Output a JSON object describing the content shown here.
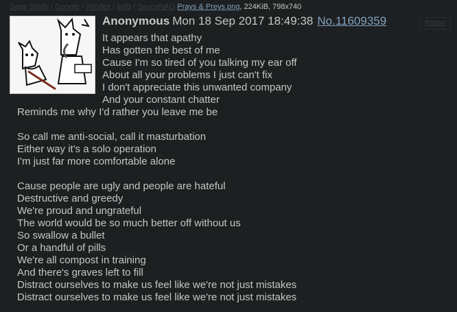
{
  "file": {
    "search_links": [
      "Sage Study",
      "Google",
      "Yandex",
      "iqdb",
      "SauceNAO"
    ],
    "filename": "Prays & Preys.png",
    "meta": ", 224KiB, 798x740"
  },
  "post": {
    "name": "Anonymous",
    "date": "Mon 18 Sep 2017 18:49:38",
    "number": "No.11609359",
    "report_label": "Report"
  },
  "body_lines": [
    "It appears that apathy",
    "Has gotten the best of me",
    "Cause I'm so tired of you talking my ear off",
    "About all your problems I just can't fix",
    "I don't appreciate this unwanted company",
    "And your constant chatter",
    "Reminds me why I'd rather you leave me be",
    "",
    "So call me anti-social, call it masturbation",
    "Either way it's a solo operation",
    "I'm just far more comfortable alone",
    "",
    "Cause people are ugly and people are hateful",
    "Destructive and greedy",
    "We're proud and ungrateful",
    "The world would be so much better off without us",
    "So swallow a bullet",
    "Or a handful of pills",
    "We're all compost in training",
    "And there's graves left to fill",
    "Distract ourselves to make us feel like we're not just mistakes",
    "Distract ourselves to make us feel like we're not just mistakes"
  ]
}
